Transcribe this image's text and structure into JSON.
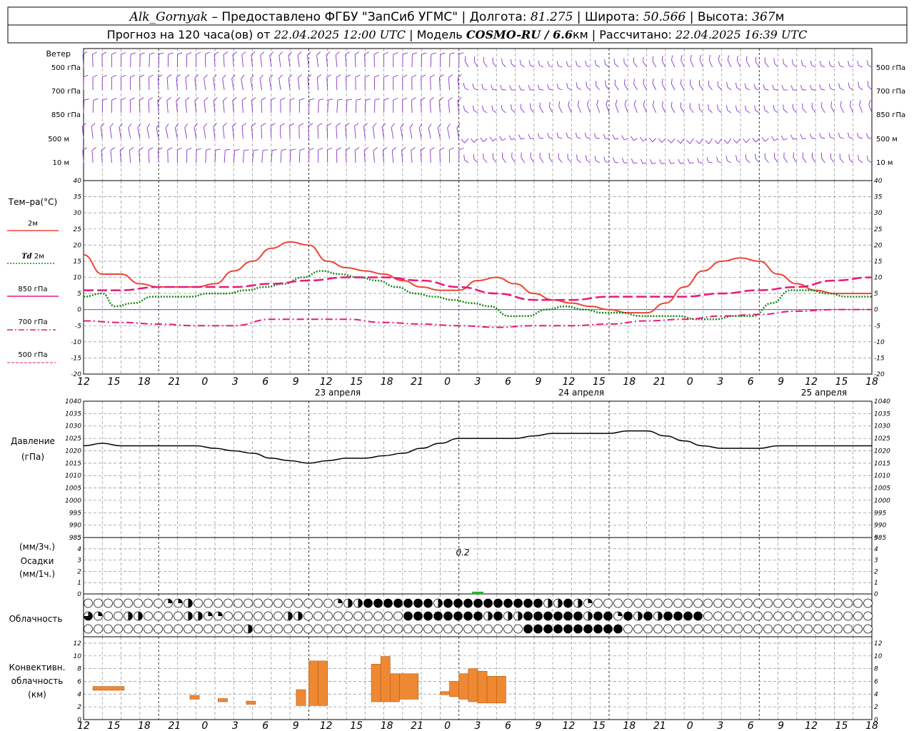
{
  "header": {
    "station": "Alk_Gornyak",
    "provider": " – Предоставлено ФГБУ \"ЗапСиб УГМС\" | Долгота: ",
    "lon": "81.275",
    "lat_label": " | Широта: ",
    "lat": "50.566",
    "alt_label": " | Высота: ",
    "alt": "367",
    "alt_unit": "м",
    "line2_a": "Прогноз на 120 часа(ов) от ",
    "issue": "22.04.2025 12:00 UTC",
    "line2_b": "  | Модель ",
    "model": "COSMO-RU / 6.6",
    "model_unit": "км",
    "line2_c": " | Рассчитано: ",
    "computed": "22.04.2025 16:39 UTC"
  },
  "labels": {
    "wind": "Ветер",
    "lev500": "500 гПа",
    "lev700": "700 гПа",
    "lev850": "850 гПа",
    "lev500m": "500 м",
    "lev10m": "10  м",
    "temp": "Тем–ра(°С)",
    "t2m": "2м",
    "td": "Td",
    "td2m": "2м",
    "t850": "850 гПа",
    "t700": "700 гПа",
    "t500": "500 гПа",
    "pressure": "Давление",
    "pressure_unit": "(гПа)",
    "precip1": "(мм/3ч.)",
    "precip2": "Осадки",
    "precip3": "(мм/1ч.)",
    "precip_note": "0.2",
    "cloud": "Облачность",
    "conv1": "Конвективн.",
    "conv2": "облачность",
    "conv3": "(км)",
    "day1": "23 апреля",
    "day2": "24 апреля",
    "day3": "25 апреля"
  },
  "colors": {
    "t2m": "#ee4433",
    "td": "#118811",
    "t850": "#e8197a",
    "wind": "#8833cc",
    "pressure": "#000000",
    "conv": "#ee8833",
    "precip": "#22bb22"
  },
  "chart_data": {
    "hour_ticks": [
      "12",
      "15",
      "18",
      "21",
      "0",
      "3",
      "6",
      "9",
      "12",
      "15",
      "18",
      "21",
      "0",
      "3",
      "6",
      "9",
      "12",
      "15",
      "18",
      "21",
      "0",
      "3",
      "6",
      "9",
      "12",
      "15",
      "18"
    ],
    "t_axis": {
      "ylim": [
        -20,
        40
      ],
      "ticks": [
        40,
        35,
        30,
        25,
        20,
        15,
        10,
        5,
        0,
        -5,
        -10,
        -15,
        -20
      ]
    },
    "p_axis": {
      "ylim": [
        985,
        1040
      ],
      "ticks": [
        1040,
        1035,
        1030,
        1025,
        1020,
        1015,
        1010,
        1005,
        1000,
        995,
        990,
        985
      ]
    },
    "precip_axis": {
      "ylim": [
        0,
        5
      ],
      "ticks": [
        5,
        4,
        3,
        2,
        1,
        0
      ]
    },
    "conv_axis": {
      "ylim": [
        0,
        13
      ],
      "ticks": [
        12,
        10,
        8,
        6,
        4,
        2,
        0
      ]
    },
    "series": [
      {
        "name": "t2m",
        "h": [
          0,
          3,
          6,
          9,
          12,
          15,
          18,
          21,
          24,
          27,
          30,
          33,
          36,
          39,
          42,
          45,
          48,
          51,
          54,
          57,
          60,
          63,
          66,
          69,
          72,
          75,
          78,
          81,
          84,
          87,
          90,
          93,
          96,
          99,
          102,
          105,
          108,
          111,
          114,
          117,
          120,
          123,
          126
        ],
        "v": [
          17,
          11,
          11,
          8,
          7,
          7,
          7,
          8,
          12,
          15,
          19,
          21,
          20,
          15,
          13,
          12,
          11,
          9,
          7,
          6,
          6,
          9,
          10,
          8,
          5,
          3,
          2,
          1,
          0,
          -1,
          -1,
          2,
          7,
          12,
          15,
          16,
          15,
          11,
          8,
          6,
          5,
          5,
          5
        ]
      },
      {
        "name": "td",
        "h": [
          0,
          3,
          5,
          8,
          11,
          14,
          17,
          20,
          23,
          26,
          29,
          32,
          35,
          38,
          41,
          44,
          47,
          50,
          53,
          56,
          59,
          62,
          65,
          68,
          71,
          74,
          77,
          80,
          83,
          86,
          89,
          92,
          95,
          98,
          101,
          104,
          107,
          110,
          113,
          116,
          119,
          122,
          126
        ],
        "v": [
          4,
          5,
          1,
          2,
          4,
          4,
          4,
          5,
          5,
          6,
          7,
          8,
          10,
          12,
          11,
          10,
          9,
          7,
          5,
          4,
          3,
          2,
          1,
          -2,
          -2,
          0,
          1,
          0,
          -1,
          -1,
          -2,
          -2,
          -2,
          -3,
          -3,
          -2,
          -2,
          2,
          6,
          6,
          5,
          4,
          4
        ]
      },
      {
        "name": "t850",
        "h": [
          0,
          6,
          12,
          18,
          24,
          30,
          36,
          42,
          48,
          54,
          60,
          66,
          72,
          78,
          84,
          90,
          96,
          102,
          108,
          114,
          120,
          126
        ],
        "v": [
          6,
          6,
          7,
          7,
          7,
          8,
          9,
          10,
          10,
          9,
          7,
          5,
          3,
          3,
          4,
          4,
          4,
          5,
          6,
          7,
          9,
          10
        ]
      },
      {
        "name": "t700",
        "h": [
          0,
          6,
          12,
          18,
          24,
          30,
          36,
          42,
          48,
          54,
          60,
          66,
          72,
          78,
          84,
          90,
          96,
          102,
          108,
          114,
          120,
          126
        ],
        "v": [
          -3.5,
          -4,
          -4.5,
          -5,
          -5,
          -3,
          -3,
          -3,
          -4,
          -4.5,
          -5,
          -5.5,
          -5,
          -5,
          -4.5,
          -3.5,
          -3,
          -2,
          -1.5,
          -0.5,
          0,
          0
        ]
      },
      {
        "name": "pressure",
        "h": [
          0,
          3,
          6,
          9,
          12,
          15,
          18,
          21,
          24,
          27,
          30,
          33,
          36,
          39,
          42,
          45,
          48,
          51,
          54,
          57,
          60,
          63,
          66,
          69,
          72,
          75,
          78,
          81,
          84,
          87,
          90,
          93,
          96,
          99,
          102,
          105,
          108,
          111,
          114,
          117,
          120,
          123,
          126
        ],
        "v": [
          1022,
          1023,
          1022,
          1022,
          1022,
          1022,
          1022,
          1021,
          1020,
          1019,
          1017,
          1016,
          1015,
          1016,
          1017,
          1017,
          1018,
          1019,
          1021,
          1023,
          1025,
          1025,
          1025,
          1025,
          1026,
          1027,
          1027,
          1027,
          1027,
          1028,
          1028,
          1026,
          1024,
          1022,
          1021,
          1021,
          1021,
          1022,
          1022,
          1022,
          1022,
          1022,
          1022
        ]
      }
    ],
    "precip": {
      "h": [
        63
      ],
      "v": [
        0.2
      ]
    },
    "conv_bars": [
      {
        "h": 1.5,
        "w": 5,
        "lo": 4.6,
        "hi": 5.2
      },
      {
        "h": 17,
        "w": 1.5,
        "lo": 3.2,
        "hi": 3.8
      },
      {
        "h": 21.5,
        "w": 1.5,
        "lo": 2.8,
        "hi": 3.3
      },
      {
        "h": 26,
        "w": 1.5,
        "lo": 2.4,
        "hi": 2.9
      },
      {
        "h": 34,
        "w": 1.5,
        "lo": 2.2,
        "hi": 4.7
      },
      {
        "h": 36,
        "w": 1.5,
        "lo": 2.2,
        "hi": 9.2
      },
      {
        "h": 37.5,
        "w": 1.5,
        "lo": 2.2,
        "hi": 9.2
      },
      {
        "h": 46,
        "w": 1.5,
        "lo": 2.8,
        "hi": 8.7
      },
      {
        "h": 47.5,
        "w": 1.5,
        "lo": 2.8,
        "hi": 9.9
      },
      {
        "h": 49,
        "w": 1.5,
        "lo": 2.8,
        "hi": 7.2
      },
      {
        "h": 50.5,
        "w": 3,
        "lo": 3.2,
        "hi": 7.2
      },
      {
        "h": 57,
        "w": 1.5,
        "lo": 3.9,
        "hi": 4.4
      },
      {
        "h": 58.5,
        "w": 1.5,
        "lo": 3.6,
        "hi": 6.0
      },
      {
        "h": 60,
        "w": 1.5,
        "lo": 3.2,
        "hi": 7.2
      },
      {
        "h": 61.5,
        "w": 1.5,
        "lo": 2.8,
        "hi": 8.0
      },
      {
        "h": 63,
        "w": 1.5,
        "lo": 2.6,
        "hi": 7.6
      },
      {
        "h": 64.5,
        "w": 1.5,
        "lo": 2.6,
        "hi": 6.8
      },
      {
        "h": 66,
        "w": 1.5,
        "lo": 2.6,
        "hi": 6.8
      }
    ],
    "cloud_rows": [
      "0000000033400000000000000344777777747777777877447430000000000000000000000000000000000000000000000000000000000000",
      "5300440000443320000044000000000077777777474477777747737474777700000000000000000000000000000000000000000000000",
      "0000000000000000400000000000000000000000000077777777770000000000000000000000000000000000000000000000000000000"
    ]
  }
}
